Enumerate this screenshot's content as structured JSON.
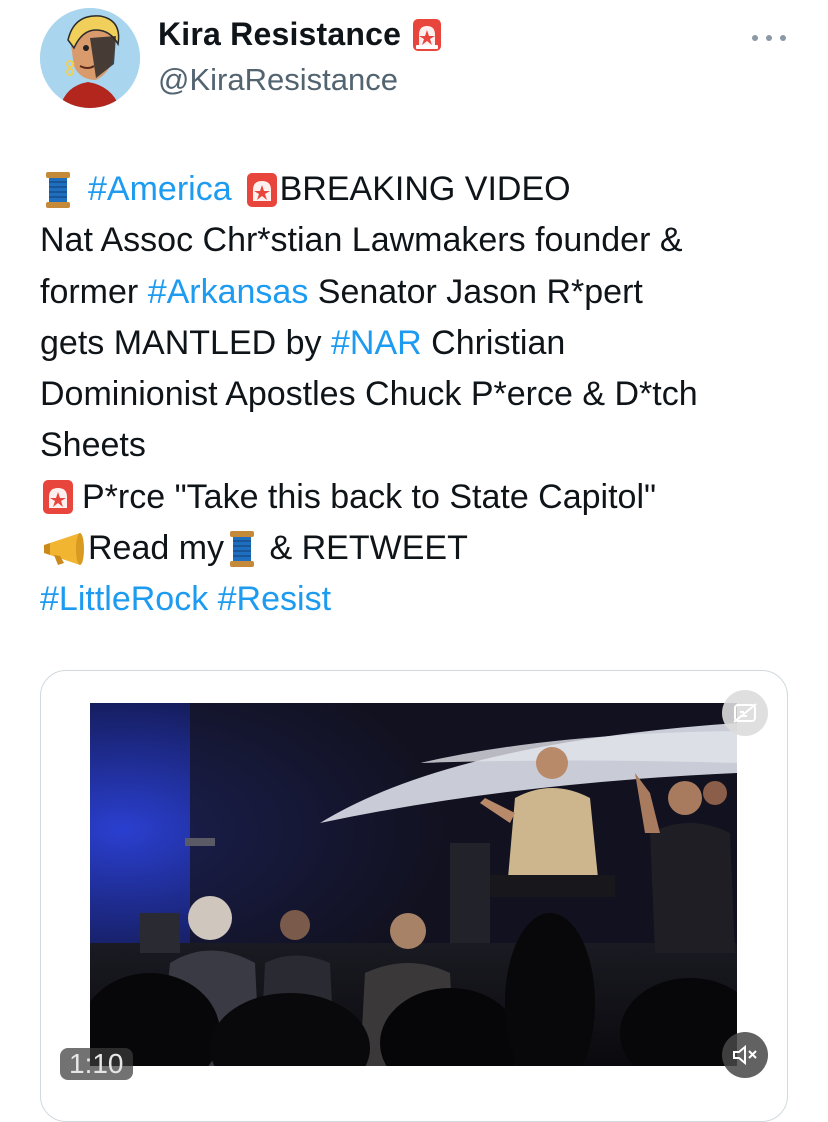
{
  "author": {
    "name": "Kira Resistance",
    "handle": "@KiraResistance",
    "badge_icon": "police-siren-icon"
  },
  "more_icon": "more-dots-icon",
  "tweet": {
    "lines": [
      {
        "tag1": "#America",
        "text1": "BREAKING VIDEO"
      },
      {
        "text": "Nat Assoc Chr*stian Lawmakers founder &"
      },
      {
        "text_pre": "former ",
        "tag": "#Arkansas",
        "text_post": " Senator Jason R*pert"
      },
      {
        "text_pre": "gets MANTLED by ",
        "tag": "#NAR",
        "text_post": " Christian"
      },
      {
        "text": "Dominionist Apostles Chuck P*erce & D*tch"
      },
      {
        "text": "Sheets"
      },
      {
        "text": "P*rce \"Take this back to State Capitol\""
      },
      {
        "text_a": "Read my",
        "text_b": " & RETWEET"
      },
      {
        "tags": "#LittleRock #Resist"
      }
    ],
    "emoji": [
      "spool-of-thread",
      "police-car-light",
      "megaphone"
    ]
  },
  "video": {
    "duration": "1:10",
    "caption_icon": "captions-off-icon",
    "mute_icon": "speaker-muted-icon"
  },
  "colors": {
    "link": "#1d9bf0",
    "text": "#0f1419",
    "secondary": "#536471",
    "border": "#cfd9de"
  }
}
